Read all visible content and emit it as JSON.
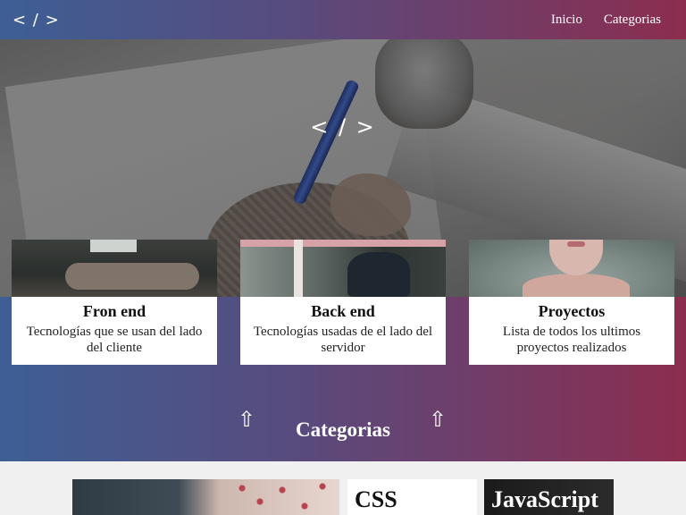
{
  "navbar": {
    "brand": "< / >",
    "links": [
      {
        "label": "Inicio"
      },
      {
        "label": "Categorias"
      }
    ]
  },
  "hero": {
    "title": "< / >"
  },
  "cards": [
    {
      "title": "Fron end",
      "text": "Tecnologías que se usan del lado del cliente",
      "image": "sleeping-person-photo"
    },
    {
      "title": "Back end",
      "text": "Tecnologías usadas de el lado del servidor",
      "image": "person-at-window-photo"
    },
    {
      "title": "Proyectos",
      "text": "Lista de todos los ultimos proyectos realizados",
      "image": "person-in-bath-photo"
    }
  ],
  "categorias": {
    "heading": "Categorias",
    "arrow_left": "⇧",
    "arrow_right": "⇧"
  },
  "category_tiles": [
    {
      "label": "",
      "image": "people-photo"
    },
    {
      "label": "CSS"
    },
    {
      "label": "JavaScript"
    }
  ],
  "colors": {
    "gradient_start": "#3d5f95",
    "gradient_end": "#8c2d4f"
  }
}
